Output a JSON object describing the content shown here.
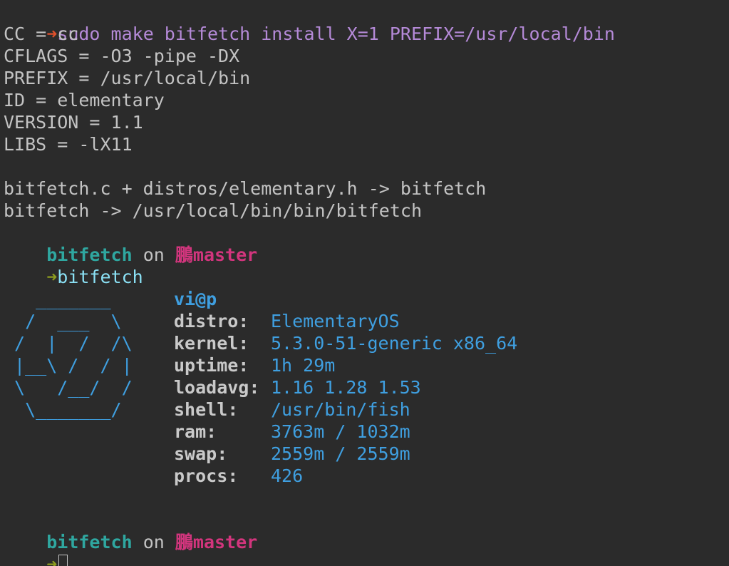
{
  "colors": {
    "background": "#2b2b2b",
    "prompt_arrow_error": "#e0502c",
    "prompt_arrow_ok": "#8d9c1f",
    "command_pending": "#b58ad8",
    "command_valid": "#8be1f5",
    "directory": "#2fa7a0",
    "git_branch": "#d2357d",
    "fetch_accent": "#3f9fe0",
    "text": "#c3c3c3"
  },
  "prompt_arrow": "➜",
  "first_command": "sudo make bitfetch install X=1 PREFIX=/usr/local/bin",
  "build_output": [
    "CC = cc",
    "CFLAGS = -O3 -pipe -DX",
    "PREFIX = /usr/local/bin",
    "ID = elementary",
    "VERSION = 1.1",
    "LIBS = -lX11",
    "",
    "bitfetch.c + distros/elementary.h -> bitfetch",
    "bitfetch -> /usr/local/bin/bin/bitfetch"
  ],
  "prompt_context": {
    "directory": "bitfetch",
    "on_word": "on",
    "branch_icon": "鵬",
    "branch": "master"
  },
  "second_command": "bitfetch",
  "fetch": {
    "logo_lines": [
      "",
      "",
      "   _______",
      "  /  ___  \\",
      " /  |  /  /\\",
      " |__\\ /  / |",
      " \\   /__/  /",
      "  \\_______/"
    ],
    "user_host": "vi@p",
    "rows": [
      {
        "key": "distro:",
        "value": "ElementaryOS"
      },
      {
        "key": "kernel:",
        "value": "5.3.0-51-generic x86_64"
      },
      {
        "key": "uptime:",
        "value": "1h 29m"
      },
      {
        "key": "loadavg:",
        "value": "1.16 1.28 1.53"
      },
      {
        "key": "shell:",
        "value": "/usr/bin/fish"
      },
      {
        "key": "ram:",
        "value": "3763m / 1032m"
      },
      {
        "key": "swap:",
        "value": "2559m / 2559m"
      },
      {
        "key": "procs:",
        "value": "426"
      }
    ]
  }
}
